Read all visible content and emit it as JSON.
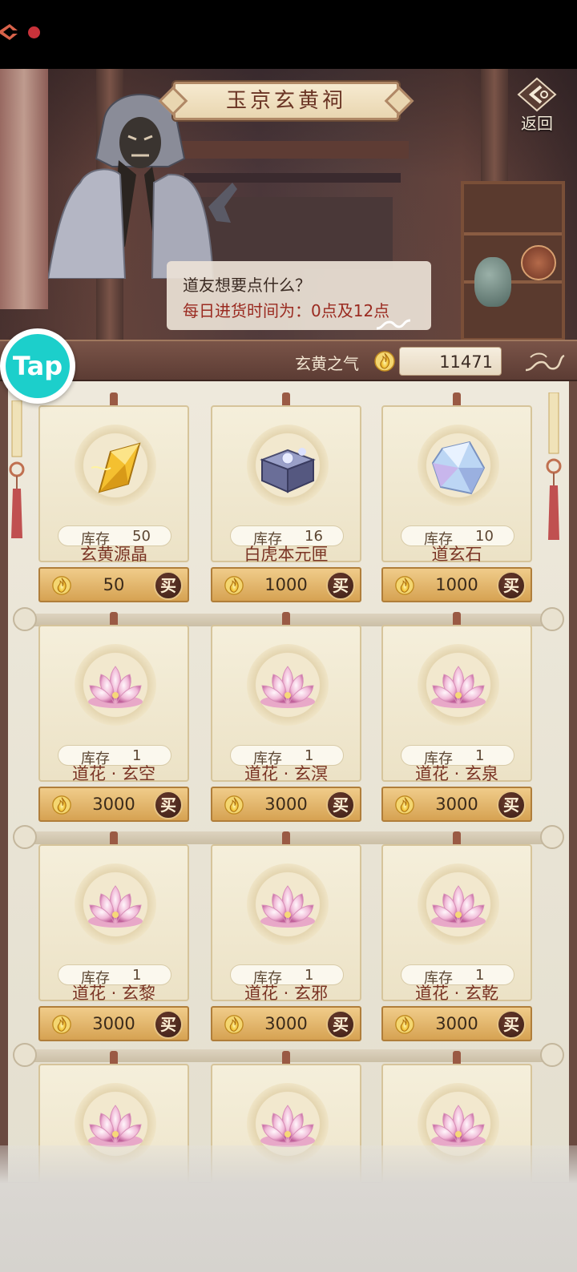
{
  "header": {
    "title": "玉京玄黄祠",
    "back_label": "返回"
  },
  "dialog": {
    "line1": "道友想要点什么？",
    "line2": "每日进货时间为：0点及12点"
  },
  "currency": {
    "label": "玄黄之气",
    "value": "11471",
    "icon": "flame-coin-icon"
  },
  "tap_badge": {
    "text": "Tap"
  },
  "shop": {
    "stock_label": "库存",
    "buy_label": "买",
    "items": [
      {
        "name": "玄黄源晶",
        "stock": "50",
        "price": "50",
        "icon": "gold-crystal-icon"
      },
      {
        "name": "白虎本元匣",
        "stock": "16",
        "price": "1000",
        "icon": "jewel-box-icon"
      },
      {
        "name": "道玄石",
        "stock": "10",
        "price": "1000",
        "icon": "blue-gem-icon"
      },
      {
        "name": "道花 · 玄空",
        "stock": "1",
        "price": "3000",
        "icon": "lotus-icon"
      },
      {
        "name": "道花 · 玄溟",
        "stock": "1",
        "price": "3000",
        "icon": "lotus-icon"
      },
      {
        "name": "道花 · 玄泉",
        "stock": "1",
        "price": "3000",
        "icon": "lotus-icon"
      },
      {
        "name": "道花 · 玄黎",
        "stock": "1",
        "price": "3000",
        "icon": "lotus-icon"
      },
      {
        "name": "道花 · 玄邪",
        "stock": "1",
        "price": "3000",
        "icon": "lotus-icon"
      },
      {
        "name": "道花 · 玄乾",
        "stock": "1",
        "price": "3000",
        "icon": "lotus-icon"
      },
      {
        "name": "",
        "stock": "",
        "price": "",
        "icon": "lotus-icon"
      },
      {
        "name": "",
        "stock": "",
        "price": "",
        "icon": "lotus-icon"
      },
      {
        "name": "",
        "stock": "",
        "price": "",
        "icon": "lotus-icon"
      }
    ]
  }
}
